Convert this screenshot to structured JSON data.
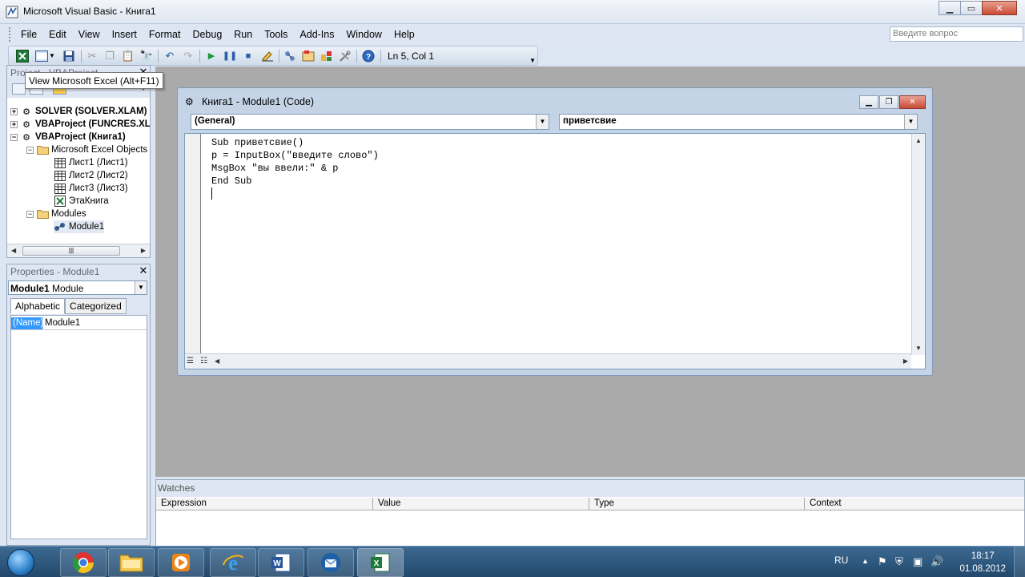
{
  "window": {
    "title": "Microsoft Visual Basic - Книга1"
  },
  "menu": [
    "File",
    "Edit",
    "View",
    "Insert",
    "Format",
    "Debug",
    "Run",
    "Tools",
    "Add-Ins",
    "Window",
    "Help"
  ],
  "ask_placeholder": "Введите вопрос",
  "toolbar": {
    "position": "Ln 5, Col 1",
    "tooltip": "View Microsoft Excel (Alt+F11)"
  },
  "project": {
    "title": "Project - VBAProject",
    "nodes": [
      {
        "label": "SOLVER (SOLVER.XLAM)",
        "bold": true,
        "icon": "vba-project-icon"
      },
      {
        "label": "VBAProject (FUNCRES.XL",
        "bold": true,
        "icon": "vba-project-icon"
      },
      {
        "label": "VBAProject (Книга1)",
        "bold": true,
        "icon": "vba-project-icon"
      },
      {
        "label": "Microsoft Excel Objects",
        "icon": "folder-icon"
      },
      {
        "label": "Лист1 (Лист1)",
        "icon": "worksheet-icon"
      },
      {
        "label": "Лист2 (Лист2)",
        "icon": "worksheet-icon"
      },
      {
        "label": "Лист3 (Лист3)",
        "icon": "worksheet-icon"
      },
      {
        "label": "ЭтаКнига",
        "icon": "workbook-icon"
      },
      {
        "label": "Modules",
        "icon": "folder-icon"
      },
      {
        "label": "Module1",
        "icon": "module-icon"
      }
    ]
  },
  "properties": {
    "title": "Properties - Module1",
    "object_name": "Module1",
    "object_type": "Module",
    "tabs": [
      "Alphabetic",
      "Categorized"
    ],
    "rows": [
      {
        "key": "(Name)",
        "value": "Module1"
      }
    ]
  },
  "code_window": {
    "title": "Книга1 - Module1 (Code)",
    "object_combo": "(General)",
    "proc_combo": "приветсвие",
    "lines": [
      "Sub приветсвие()",
      "p = InputBox(\"введите слово\")",
      "MsgBox \"вы ввели:\" & p",
      "End Sub",
      ""
    ]
  },
  "watches": {
    "title": "Watches",
    "columns": [
      "Expression",
      "Value",
      "Type",
      "Context"
    ]
  },
  "taskbar": {
    "lang": "RU",
    "time": "18:17",
    "date": "01.08.2012",
    "apps": [
      "chrome-icon",
      "explorer-icon",
      "media-player-icon",
      "internet-explorer-icon",
      "word-icon",
      "thunderbird-icon",
      "excel-icon"
    ]
  }
}
